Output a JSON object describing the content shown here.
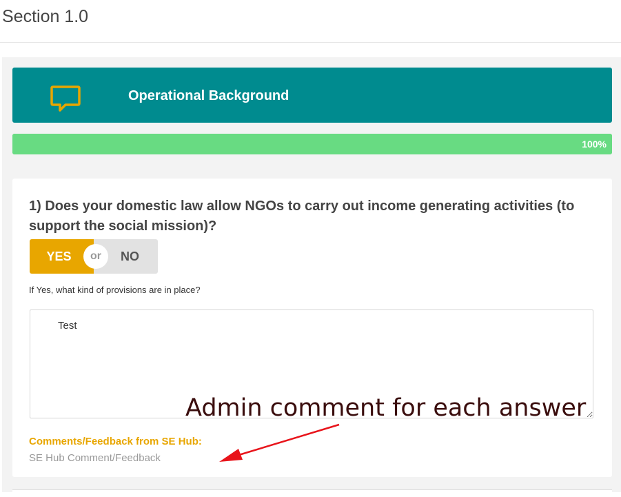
{
  "header": {
    "title": "Section 1.0"
  },
  "section": {
    "title": "Operational Background",
    "icon": "chat-bubble-icon",
    "accent_color": "#008b8f",
    "icon_color": "#e8a600"
  },
  "progress": {
    "percent": 100,
    "label": "100%",
    "color": "#68db82"
  },
  "question": {
    "text": "1) Does your domestic law allow NGOs to carry out income generating activities (to support the social mission)?",
    "yes_label": "YES",
    "or_label": "or",
    "no_label": "NO",
    "selected": "YES",
    "followup_label": "If Yes, what kind of provisions are in place?",
    "answer_value": "Test"
  },
  "feedback": {
    "heading": "Comments/Feedback from SE Hub:",
    "placeholder_text": "SE Hub Comment/Feedback"
  },
  "annotation": {
    "text": "Admin comment for each answer",
    "arrow_color": "#e8141b"
  }
}
